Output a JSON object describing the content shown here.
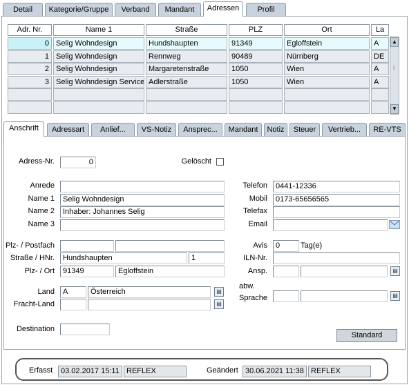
{
  "top_tabs": [
    {
      "label": "Detail"
    },
    {
      "label": "Kategorie/Gruppe"
    },
    {
      "label": "Verband"
    },
    {
      "label": "Mandant"
    },
    {
      "label": "Adressen"
    },
    {
      "label": "Profil"
    }
  ],
  "grid": {
    "columns": [
      "Adr. Nr.",
      "Name 1",
      "Straße",
      "PLZ",
      "Ort",
      "La"
    ],
    "rows": [
      [
        "0",
        "Selig Wohndesign",
        "Hundshaupten",
        "91349",
        "Egloffstein",
        "A"
      ],
      [
        "1",
        "Selig Wohndesign",
        "Rennweg",
        "90489",
        "Nürnberg",
        "DE"
      ],
      [
        "2",
        "Selig Wohndesign",
        "Margaretenstraße",
        "1050",
        "Wien",
        "A"
      ],
      [
        "3",
        "Selig Wohndesign Service",
        "Adlerstraße",
        "1050",
        "Wien",
        "A"
      ],
      [
        "",
        "",
        "",
        "",
        "",
        ""
      ],
      [
        "",
        "",
        "",
        "",
        "",
        ""
      ]
    ]
  },
  "sub_tabs": [
    {
      "label": "Anschrift"
    },
    {
      "label": "Adressart"
    },
    {
      "label": "Anlief..."
    },
    {
      "label": "VS-Notiz"
    },
    {
      "label": "Ansprec..."
    },
    {
      "label": "Mandant"
    },
    {
      "label": "Notiz"
    },
    {
      "label": "Steuer"
    },
    {
      "label": "Vertrieb..."
    },
    {
      "label": "RE-VTS"
    }
  ],
  "form": {
    "adress_nr_label": "Adress-Nr.",
    "adress_nr": "0",
    "geloescht_label": "Gelöscht",
    "anrede_label": "Anrede",
    "anrede": "",
    "name1_label": "Name 1",
    "name1": "Selig Wohndesign",
    "name2_label": "Name 2",
    "name2": "Inhaber: Johannes Selig",
    "name3_label": "Name 3",
    "name3": "",
    "telefon_label": "Telefon",
    "telefon": "0441-12336",
    "mobil_label": "Mobil",
    "mobil": "0173-65656565",
    "telefax_label": "Telefax",
    "telefax": "",
    "email_label": "Email",
    "email": "",
    "plz_postfach_label": "Plz- / Postfach",
    "plz_postfach": "",
    "postfach": "",
    "strasse_label": "Straße / HNr.",
    "strasse": "Hundshaupten",
    "hnr": "1",
    "plz_ort_label": "Plz- / Ort",
    "plz": "91349",
    "ort": "Egloffstein",
    "avis_label": "Avis",
    "avis": "0",
    "avis_unit": "Tag(e)",
    "iln_label": "ILN-Nr.",
    "iln": "",
    "ansp_label": "Ansp.",
    "ansp_code": "",
    "ansp_name": "",
    "land_label": "Land",
    "land_code": "A",
    "land_name": "Österreich",
    "fracht_land_label": "Fracht-Land",
    "fracht_land_code": "",
    "fracht_land_name": "",
    "abw_label": "abw.",
    "sprache_label": "Sprache",
    "sprache_code": "",
    "sprache_name": "",
    "destination_label": "Destination",
    "destination": "",
    "standard_button": "Standard"
  },
  "footer": {
    "erfasst_label": "Erfasst",
    "erfasst_date": "03.02.2017 15:11",
    "erfasst_user": "REFLEX",
    "geaendert_label": "Geändert",
    "geaendert_date": "30.06.2021 11:38",
    "geaendert_user": "REFLEX"
  },
  "icons": {
    "lookup": "lookup-icon",
    "mail": "mail-icon",
    "scroll_up": "scroll-up-icon",
    "scroll_down": "scroll-down-icon"
  },
  "colors": {
    "tab_bg": "#c9d3dd",
    "selected_row": "#e7fbff",
    "grid_cell": "#e8ecf0"
  }
}
